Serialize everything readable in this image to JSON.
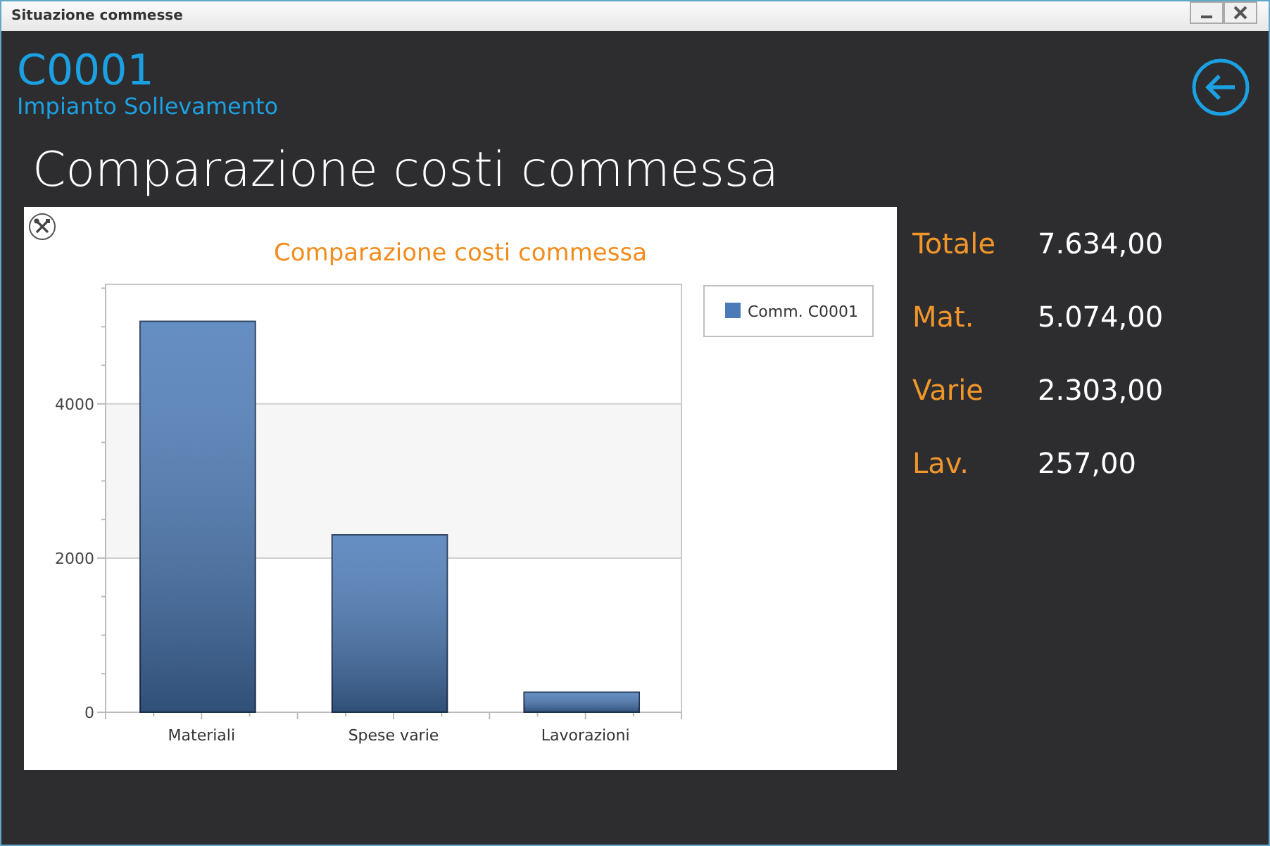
{
  "window": {
    "title": "Situazione commesse"
  },
  "header": {
    "code": "C0001",
    "description": "Impianto Sollevamento"
  },
  "page_title": "Comparazione costi commessa",
  "chart": {
    "chart_data": {
      "type": "bar",
      "title": "Comparazione costi commessa",
      "categories": [
        "Materiali",
        "Spese varie",
        "Lavorazioni"
      ],
      "series": [
        {
          "name": "Comm. C0001",
          "color": "#4a7ab8",
          "values": [
            5070,
            2300,
            260
          ]
        }
      ],
      "ylim": [
        0,
        5550
      ],
      "bands": [
        {
          "axis": "y",
          "from": 2000,
          "to": 4000
        }
      ],
      "yticks": [
        0,
        2000,
        4000
      ]
    }
  },
  "totals": [
    {
      "label": "Totale",
      "value": "7.634,00"
    },
    {
      "label": "Mat.",
      "value": "5.074,00"
    },
    {
      "label": "Varie",
      "value": "2.303,00"
    },
    {
      "label": "Lav.",
      "value": "257,00"
    }
  ]
}
